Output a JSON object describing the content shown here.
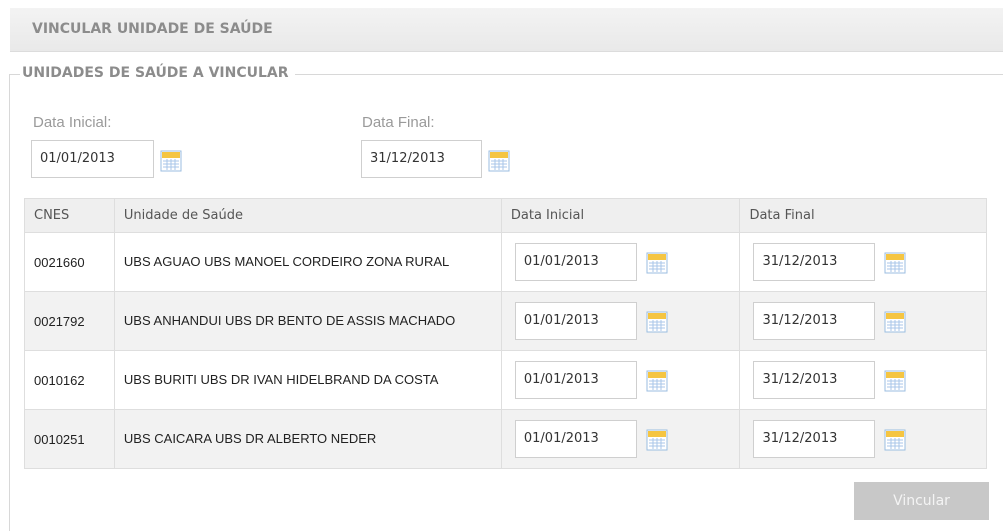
{
  "header": {
    "title": "VINCULAR UNIDADE DE SAÚDE"
  },
  "section": {
    "legend": "UNIDADES DE SAÚDE A VINCULAR"
  },
  "filters": {
    "start_label": "Data Inicial:",
    "start_value": "01/01/2013",
    "end_label": "Data Final:",
    "end_value": "31/12/2013"
  },
  "table": {
    "headers": [
      "CNES",
      "Unidade de Saúde",
      "Data Inicial",
      "Data Final"
    ],
    "rows": [
      {
        "cnes": "0021660",
        "unit": "UBS AGUAO UBS MANOEL CORDEIRO ZONA RURAL",
        "start": "01/01/2013",
        "end": "31/12/2013"
      },
      {
        "cnes": "0021792",
        "unit": "UBS ANHANDUI UBS DR BENTO DE ASSIS MACHADO",
        "start": "01/01/2013",
        "end": "31/12/2013"
      },
      {
        "cnes": "0010162",
        "unit": "UBS BURITI UBS DR IVAN HIDELBRAND DA COSTA",
        "start": "01/01/2013",
        "end": "31/12/2013"
      },
      {
        "cnes": "0010251",
        "unit": "UBS CAICARA UBS DR ALBERTO NEDER",
        "start": "01/01/2013",
        "end": "31/12/2013"
      }
    ]
  },
  "actions": {
    "submit_label": "Vincular"
  },
  "icons": {
    "calendar": "calendar-icon"
  },
  "colors": {
    "calendar_yellow": "#f5c542",
    "calendar_blue": "#8fb8e6",
    "button_disabled": "#c8c8c8"
  }
}
